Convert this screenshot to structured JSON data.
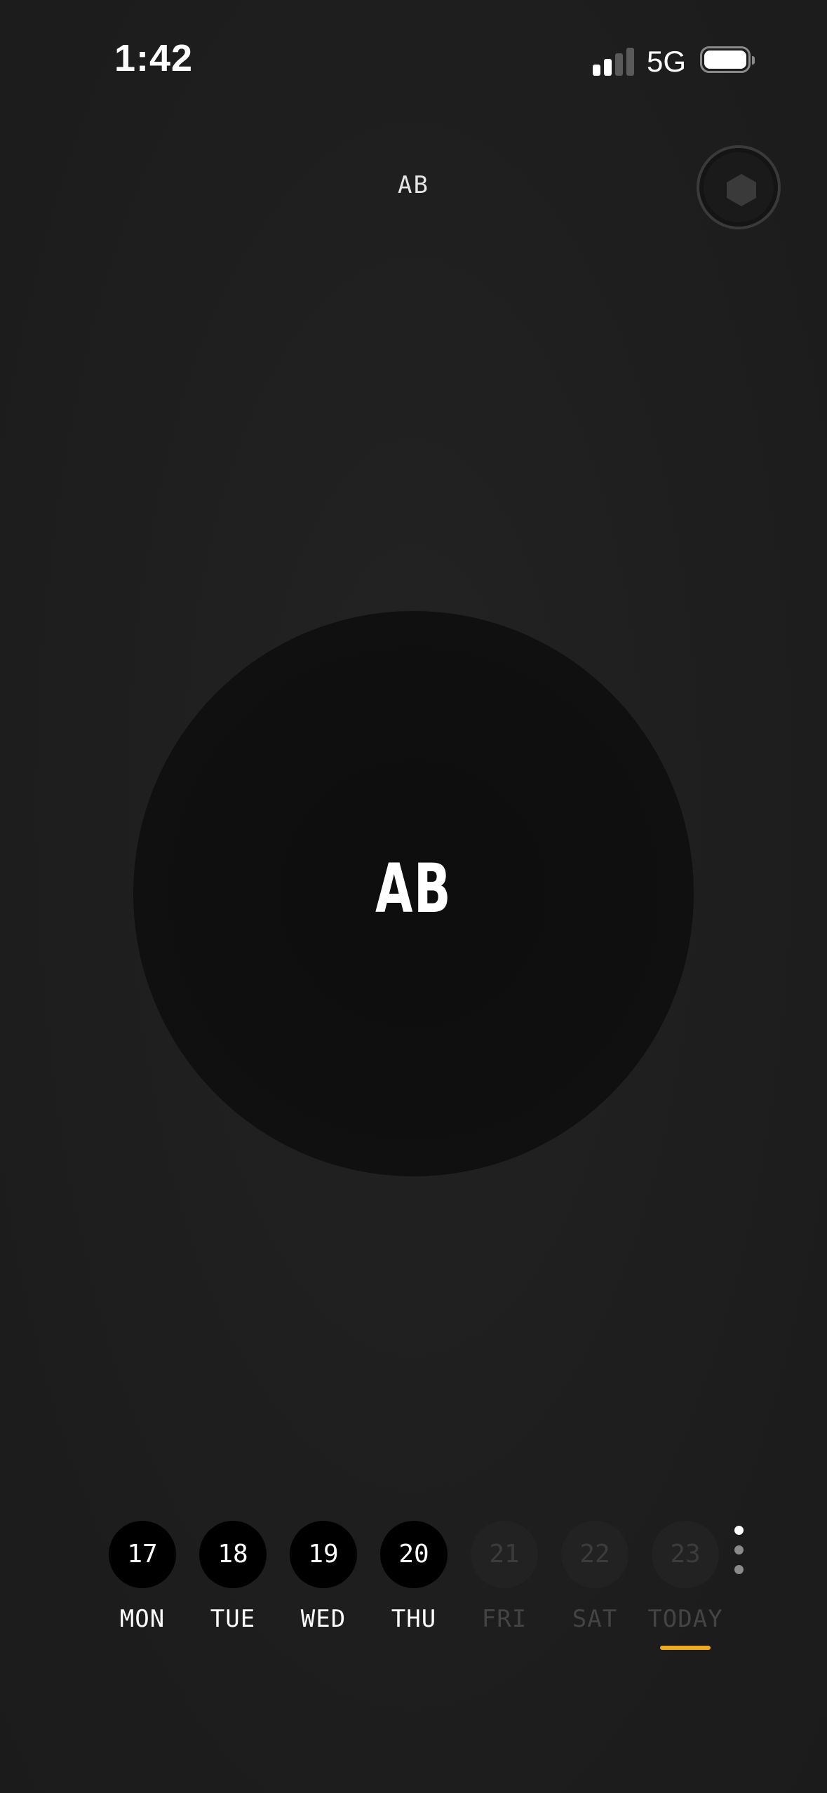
{
  "status_bar": {
    "time": "1:42",
    "network": "5G",
    "signal_bars_active": 2,
    "signal_bars_total": 4
  },
  "header": {
    "title": "AB",
    "corner_icon": "hexagon-icon"
  },
  "main": {
    "circle_label": "AB"
  },
  "week": {
    "days": [
      {
        "num": "17",
        "name": "MON",
        "state": "active"
      },
      {
        "num": "18",
        "name": "TUE",
        "state": "active"
      },
      {
        "num": "19",
        "name": "WED",
        "state": "active"
      },
      {
        "num": "20",
        "name": "THU",
        "state": "active"
      },
      {
        "num": "21",
        "name": "FRI",
        "state": "future"
      },
      {
        "num": "22",
        "name": "SAT",
        "state": "future"
      },
      {
        "num": "23",
        "name": "TODAY",
        "state": "future"
      }
    ],
    "more_icon": "more-vertical-icon"
  },
  "colors": {
    "accent": "#f0a81c",
    "dot_active": "#ffffff",
    "dot_inactive": "#8a8a8a",
    "signal_active": "#ffffff",
    "signal_inactive": "#5a5a5a",
    "icon_fill": "#3a3a3a"
  }
}
